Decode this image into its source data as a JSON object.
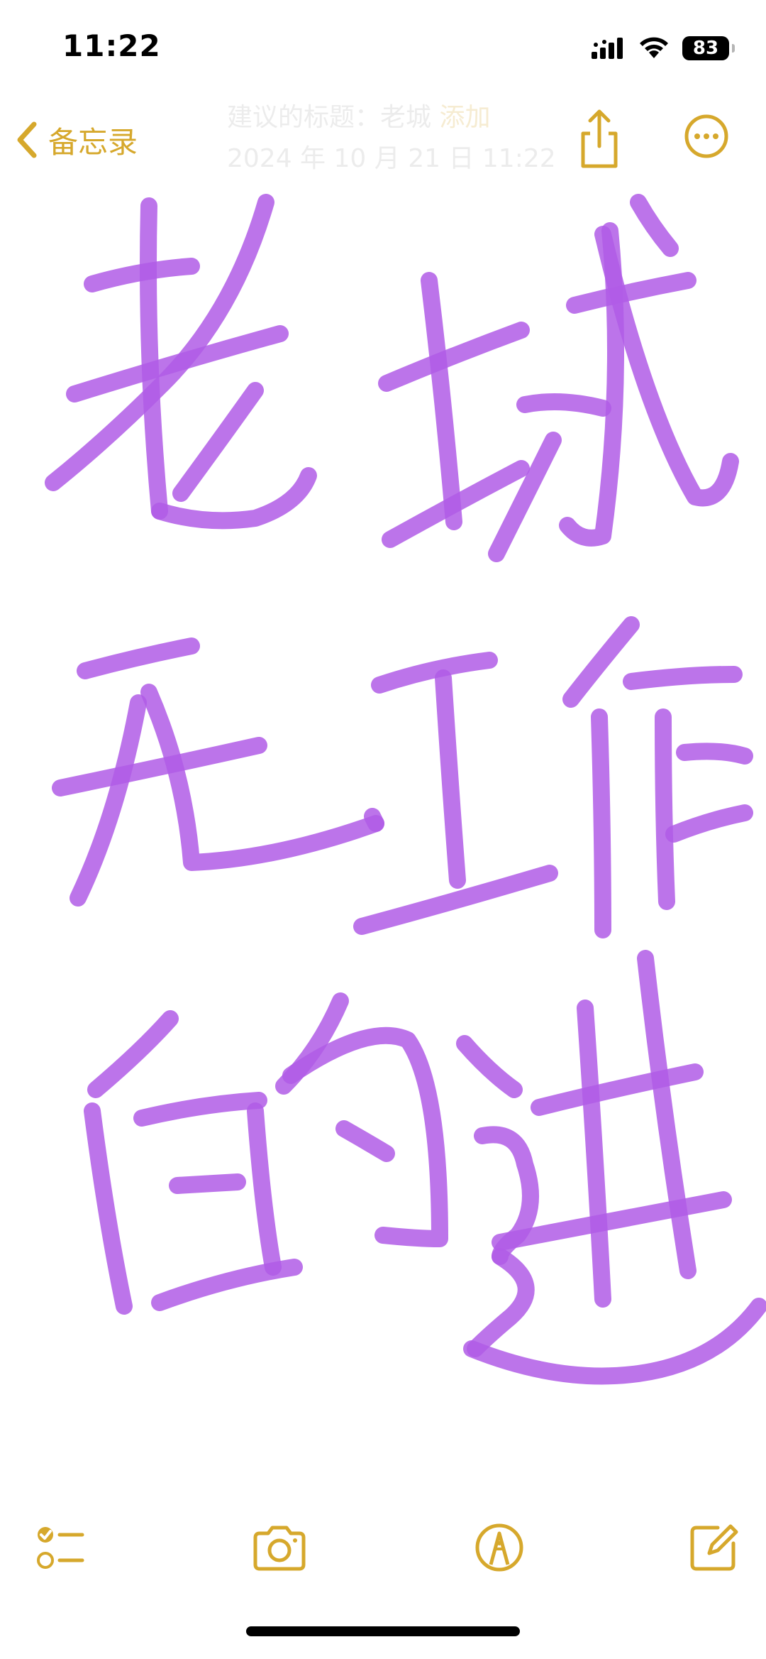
{
  "status_bar": {
    "time": "11:22",
    "battery_level": "83",
    "signal_icon": "cellular-signal-icon",
    "wifi_icon": "wifi-icon"
  },
  "nav": {
    "back_label": "备忘录",
    "back_icon": "chevron-left-icon",
    "suggested_title_prefix": "建议的标题：",
    "suggested_title_value": "老城",
    "suggested_title_action": "添加",
    "timestamp": "2024 年 10 月 21 日 11:22",
    "share_icon": "share-icon",
    "more_icon": "ellipsis-circle-icon"
  },
  "handwriting": {
    "ink_color": "#b05ce6",
    "text": "老城无工作的进"
  },
  "toolbar": {
    "checklist_icon": "checklist-icon",
    "camera_icon": "camera-icon",
    "markup_icon": "markup-pen-icon",
    "compose_icon": "compose-icon"
  },
  "colors": {
    "accent": "#d6a82c",
    "ink": "#b05ce6",
    "background": "#ffffff"
  }
}
